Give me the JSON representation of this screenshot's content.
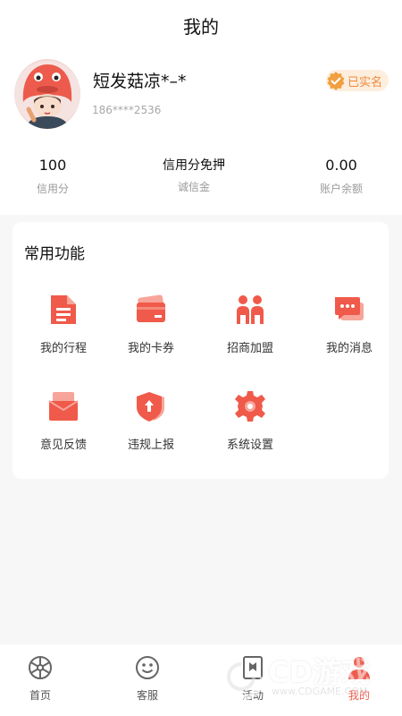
{
  "header": {
    "title": "我的"
  },
  "profile": {
    "name": "短发菇凉*–*",
    "phone": "186****2536",
    "badge": "已实名"
  },
  "stats": [
    {
      "value": "100",
      "label": "信用分"
    },
    {
      "value": "信用分免押",
      "label": "诚信金"
    },
    {
      "value": "0.00",
      "label": "账户余额"
    }
  ],
  "functions": {
    "title": "常用功能",
    "items": [
      {
        "label": "我的行程",
        "icon": "document-icon"
      },
      {
        "label": "我的卡券",
        "icon": "card-icon"
      },
      {
        "label": "招商加盟",
        "icon": "people-icon"
      },
      {
        "label": "我的消息",
        "icon": "message-icon"
      },
      {
        "label": "意见反馈",
        "icon": "envelope-icon"
      },
      {
        "label": "违规上报",
        "icon": "shield-upload-icon"
      },
      {
        "label": "系统设置",
        "icon": "gear-icon"
      }
    ]
  },
  "tabbar": {
    "items": [
      {
        "label": "首页",
        "icon": "wheel-icon"
      },
      {
        "label": "客服",
        "icon": "smile-icon"
      },
      {
        "label": "活动",
        "icon": "bookmark-icon"
      },
      {
        "label": "我的",
        "icon": "user-icon",
        "active": true
      }
    ]
  },
  "watermark": {
    "big": "CD游戏",
    "small": "www.CDGAME.COM"
  },
  "colors": {
    "accent": "#f05a4a",
    "badge_bg": "#fdeede",
    "badge_text": "#ee8a3c",
    "background": "#f7f7f7"
  }
}
